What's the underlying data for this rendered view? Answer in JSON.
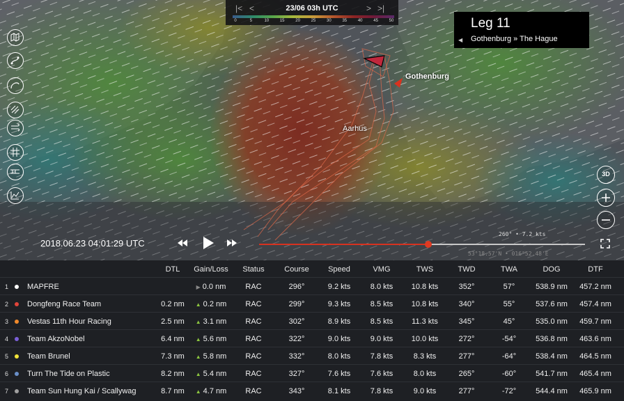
{
  "timebar": {
    "date": "23/06 03h UTC",
    "nav_first": "|<",
    "nav_prev": "<",
    "nav_next": ">",
    "nav_last": ">|",
    "wind_scale": [
      "0",
      "5",
      "10",
      "15",
      "20",
      "25",
      "30",
      "35",
      "40",
      "45",
      "50"
    ]
  },
  "leg": {
    "title": "Leg 11",
    "route": "Gothenburg » The Hague"
  },
  "map": {
    "label_gothenburg": "Gothenburg",
    "label_aarhus": "Aarhus",
    "playback_time": "2018.06.23 04:01:29 UTC",
    "wind_readout": "260° • 7.2 kts",
    "coord_readout": "53°18.57'N • 016°52.48'E",
    "timeline_progress": 0.52,
    "btn_3d": "3D"
  },
  "colors": {
    "accent_red": "#d8321f",
    "gain_arrow": "#8cc63f",
    "neutral_arrow": "#888888"
  },
  "table": {
    "columns": [
      "DTL",
      "Gain/Loss",
      "Status",
      "Course",
      "Speed",
      "VMG",
      "TWS",
      "TWD",
      "TWA",
      "DOG",
      "DTF"
    ],
    "rows": [
      {
        "rank": "1",
        "team": "MAPFRE",
        "color": "#ffffff",
        "dtl": "",
        "gain_dir": "neutral",
        "gain": "0.0 nm",
        "status": "RAC",
        "course": "296°",
        "speed": "9.2 kts",
        "vmg": "8.0 kts",
        "tws": "10.8 kts",
        "twd": "352°",
        "twa": "57°",
        "dog": "538.9 nm",
        "dtf": "457.2 nm"
      },
      {
        "rank": "2",
        "team": "Dongfeng Race Team",
        "color": "#e0443a",
        "dtl": "0.2 nm",
        "gain_dir": "up",
        "gain": "0.2 nm",
        "status": "RAC",
        "course": "299°",
        "speed": "9.3 kts",
        "vmg": "8.5 kts",
        "tws": "10.8 kts",
        "twd": "340°",
        "twa": "55°",
        "dog": "537.6 nm",
        "dtf": "457.4 nm"
      },
      {
        "rank": "3",
        "team": "Vestas 11th Hour Racing",
        "color": "#f08a2c",
        "dtl": "2.5 nm",
        "gain_dir": "up",
        "gain": "3.1 nm",
        "status": "RAC",
        "course": "302°",
        "speed": "8.9 kts",
        "vmg": "8.5 kts",
        "tws": "11.3 kts",
        "twd": "345°",
        "twa": "45°",
        "dog": "535.0 nm",
        "dtf": "459.7 nm"
      },
      {
        "rank": "4",
        "team": "Team AkzoNobel",
        "color": "#7a5fd6",
        "dtl": "6.4 nm",
        "gain_dir": "up",
        "gain": "5.6 nm",
        "status": "RAC",
        "course": "322°",
        "speed": "9.0 kts",
        "vmg": "9.0 kts",
        "tws": "10.0 kts",
        "twd": "272°",
        "twa": "-54°",
        "dog": "536.8 nm",
        "dtf": "463.6 nm"
      },
      {
        "rank": "5",
        "team": "Team Brunel",
        "color": "#f2e43a",
        "dtl": "7.3 nm",
        "gain_dir": "up",
        "gain": "5.8 nm",
        "status": "RAC",
        "course": "332°",
        "speed": "8.0 kts",
        "vmg": "7.8 kts",
        "tws": "8.3 kts",
        "twd": "277°",
        "twa": "-64°",
        "dog": "538.4 nm",
        "dtf": "464.5 nm"
      },
      {
        "rank": "6",
        "team": "Turn The Tide on Plastic",
        "color": "#6a8fc8",
        "dtl": "8.2 nm",
        "gain_dir": "up",
        "gain": "5.4 nm",
        "status": "RAC",
        "course": "327°",
        "speed": "7.6 kts",
        "vmg": "7.6 kts",
        "tws": "8.0 kts",
        "twd": "265°",
        "twa": "-60°",
        "dog": "541.7 nm",
        "dtf": "465.4 nm"
      },
      {
        "rank": "7",
        "team": "Team Sun Hung Kai / Scallywag",
        "color": "#a0a0a0",
        "dtl": "8.7 nm",
        "gain_dir": "up",
        "gain": "4.7 nm",
        "status": "RAC",
        "course": "343°",
        "speed": "8.1 kts",
        "vmg": "7.8 kts",
        "tws": "9.0 kts",
        "twd": "277°",
        "twa": "-72°",
        "dog": "544.4 nm",
        "dtf": "465.9 nm"
      }
    ]
  }
}
